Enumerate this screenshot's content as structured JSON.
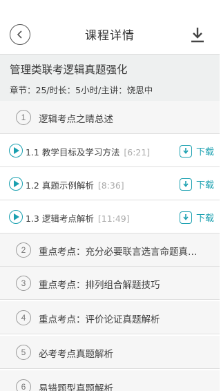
{
  "header": {
    "title": "课程详情",
    "back_icon": "chevron-left-icon",
    "download_icon": "download-icon"
  },
  "course": {
    "title": "管理类联考逻辑真题强化",
    "meta": "章节：25/时长：5小时/主讲：饶思中"
  },
  "chapters": [
    {
      "num": "1",
      "title": "逻辑考点之睛总述"
    },
    {
      "num": "2",
      "title": "重点考点：充分必要联言选言命题真…"
    },
    {
      "num": "3",
      "title": "重点考点：排列组合解题技巧"
    },
    {
      "num": "4",
      "title": "重点考点：评价论证真题解析"
    },
    {
      "num": "5",
      "title": "必考考点真题解析"
    },
    {
      "num": "6",
      "title": "易错题型真题解析"
    }
  ],
  "lessons": [
    {
      "title": "1.1 教学目标及学习方法",
      "duration": "[6:21]",
      "download_label": "下载"
    },
    {
      "title": "1.2 真题示例解析",
      "duration": "[8:36]",
      "download_label": "下载"
    },
    {
      "title": "1.3 逻辑考点解析",
      "duration": "[11:49]",
      "download_label": "下载"
    }
  ],
  "colors": {
    "accent": "#1aa0b0",
    "header_bg": "#eef0f0"
  }
}
